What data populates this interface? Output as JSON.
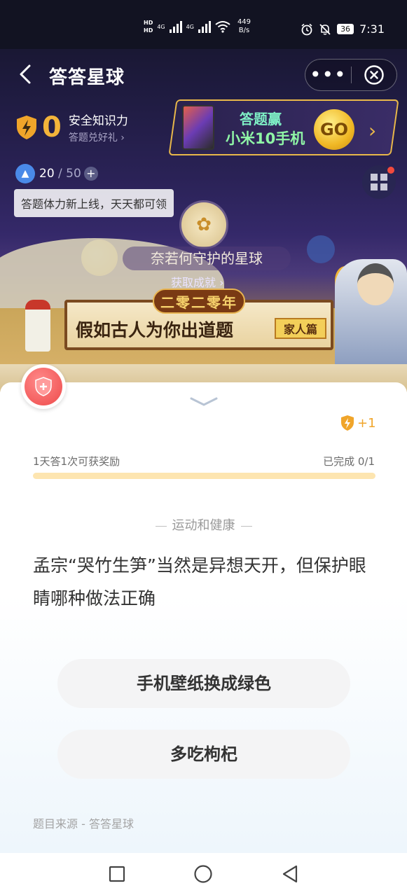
{
  "status_bar": {
    "hd1": "HD",
    "hd2": "HD",
    "net1": "4G",
    "net2": "4G",
    "speed": "449",
    "speed_unit": "B/s",
    "battery": "36",
    "time": "7:31"
  },
  "navbar": {
    "title": "答答星球",
    "more": "•••"
  },
  "banner": {
    "safety_points": "0",
    "safety_label": "安全知识力",
    "safety_sub": "答题兑好礼 ›",
    "promo_line1": "答题赢",
    "promo_line2": "小米10手机",
    "go_label": "GO"
  },
  "stamina": {
    "current": "20",
    "max": "/ 50",
    "plus": "+",
    "tooltip": "答题体力新上线，天天都可领"
  },
  "planet": {
    "name": "奈若何守护的星球",
    "achievement": "获取成就 ›"
  },
  "event": {
    "year": "二零二零年",
    "title": "假如古人为你出道题",
    "subtitle": "家人篇"
  },
  "card": {
    "bonus": "+1",
    "reward_text": "1天答1次可获奖励",
    "completed": "已完成 0/1",
    "progress": 0,
    "category": "运动和健康",
    "question": "孟宗“哭竹生笋”当然是异想天开，但保护眼睛哪种做法正确",
    "options": [
      {
        "label": "手机壁纸换成绿色"
      },
      {
        "label": "多吃枸杞"
      }
    ],
    "source": "题目来源 - 答答星球"
  },
  "colors": {
    "accent_gold": "#f0a52a",
    "progress_track": "#fde5b0",
    "badge_red": "#ee4a4a"
  }
}
